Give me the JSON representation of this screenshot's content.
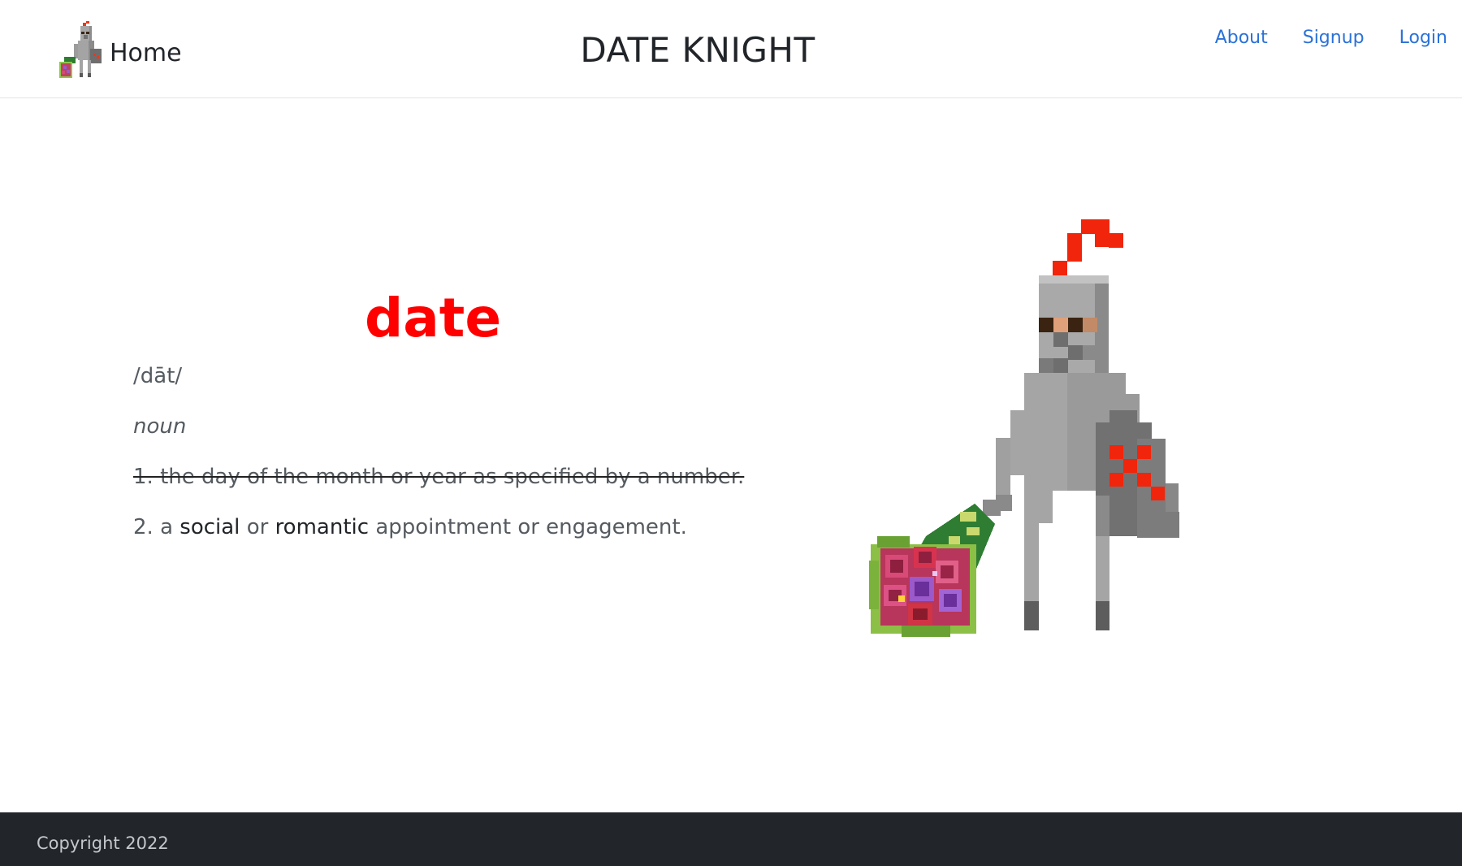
{
  "nav": {
    "home_label": "Home",
    "site_title": "DATE KNIGHT",
    "links": {
      "about": "About",
      "signup": "Signup",
      "login": "Login"
    },
    "link_color": "#2a71d8"
  },
  "definition": {
    "word": "date",
    "word_color": "#ff0000",
    "pronunciation": "/dāt/",
    "part_of_speech": "noun",
    "sense_1": "1. the day of the month or year as specified by a number.",
    "sense_2": {
      "prefix": "2. a",
      "word_a": "social",
      "connector": "or",
      "word_b": "romantic",
      "suffix": "appointment or engagement."
    }
  },
  "illustration": {
    "name": "pixel-knight-with-bouquet"
  },
  "footer": {
    "copyright": "Copyright 2022",
    "background": "#22252a"
  }
}
